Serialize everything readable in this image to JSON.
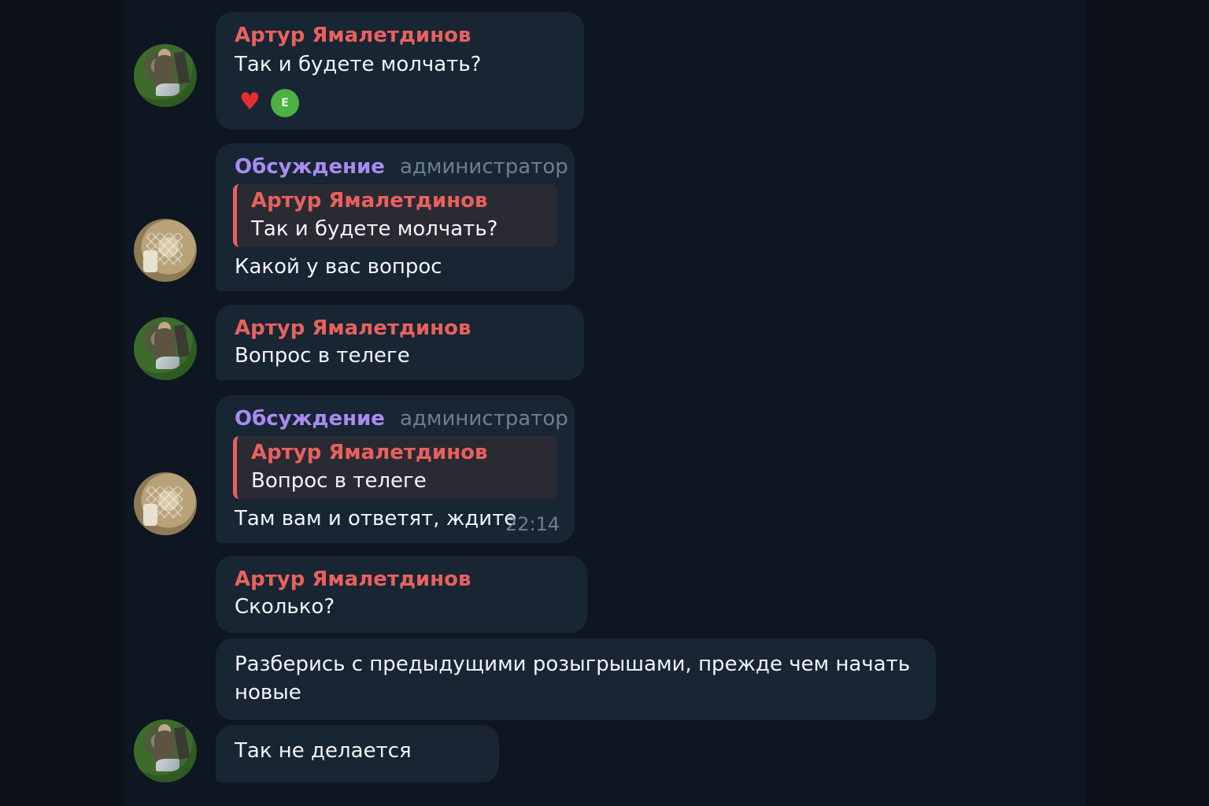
{
  "messages": [
    {
      "author": "Артур Ямалетдинов",
      "text": "Так и будете молчать?",
      "reactions": {
        "heart": "♥",
        "badge": "E"
      }
    },
    {
      "author": "Обсуждение",
      "role": "администратор",
      "reply": {
        "author": "Артур Ямалетдинов",
        "text": "Так и будете молчать?"
      },
      "text": "Какой у вас вопрос"
    },
    {
      "author": "Артур Ямалетдинов",
      "text": "Вопрос в телеге"
    },
    {
      "author": "Обсуждение",
      "role": "администратор",
      "reply": {
        "author": "Артур Ямалетдинов",
        "text": "Вопрос в телеге"
      },
      "text": "Там вам и ответят, ждите",
      "time": "22:14"
    },
    {
      "author": "Артур Ямалетдинов",
      "text": "Сколько?"
    },
    {
      "text_line1": "Разберись с предыдущими розыгрышами, прежде чем начать",
      "text_line2": "новые"
    },
    {
      "text": "Так не делается"
    }
  ],
  "colors": {
    "background": "#0e1621",
    "bubble": "#182533",
    "user_name": "#e8615e",
    "admin_name": "#a98bf2",
    "role": "#6d7f8f"
  }
}
